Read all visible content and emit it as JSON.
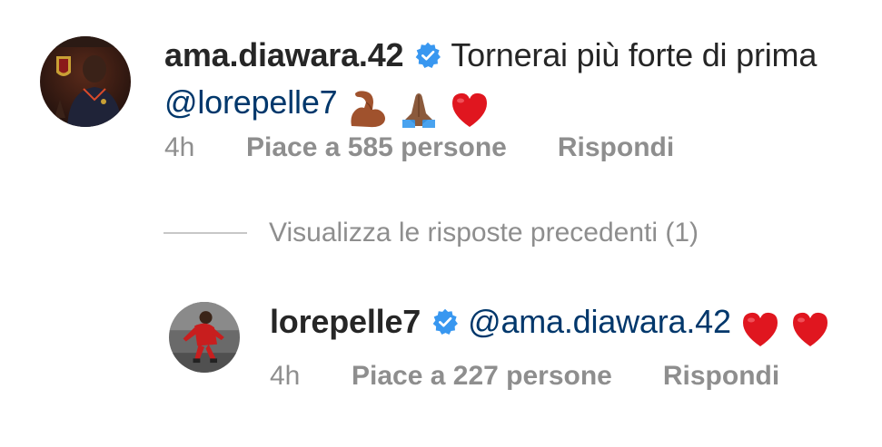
{
  "comments": [
    {
      "username": "ama.diawara.42",
      "verified": true,
      "text": "Tornerai più forte di prima",
      "mention": "@lorepelle7",
      "emojis": [
        "flexed-biceps",
        "folded-hands",
        "red-heart"
      ],
      "time": "4h",
      "likes": "Piace a 585 persone",
      "reply": "Rispondi"
    }
  ],
  "view_previous_replies": "Visualizza le risposte precedenti (1)",
  "replies": [
    {
      "username": "lorepelle7",
      "verified": true,
      "mention": "@ama.diawara.42",
      "emojis": [
        "red-heart",
        "red-heart"
      ],
      "time": "4h",
      "likes": "Piace a 227 persone",
      "reply": "Rispondi"
    }
  ],
  "colors": {
    "mention": "#00376b",
    "meta": "#8e8e8e",
    "verified": "#3897f0",
    "text": "#262626"
  }
}
